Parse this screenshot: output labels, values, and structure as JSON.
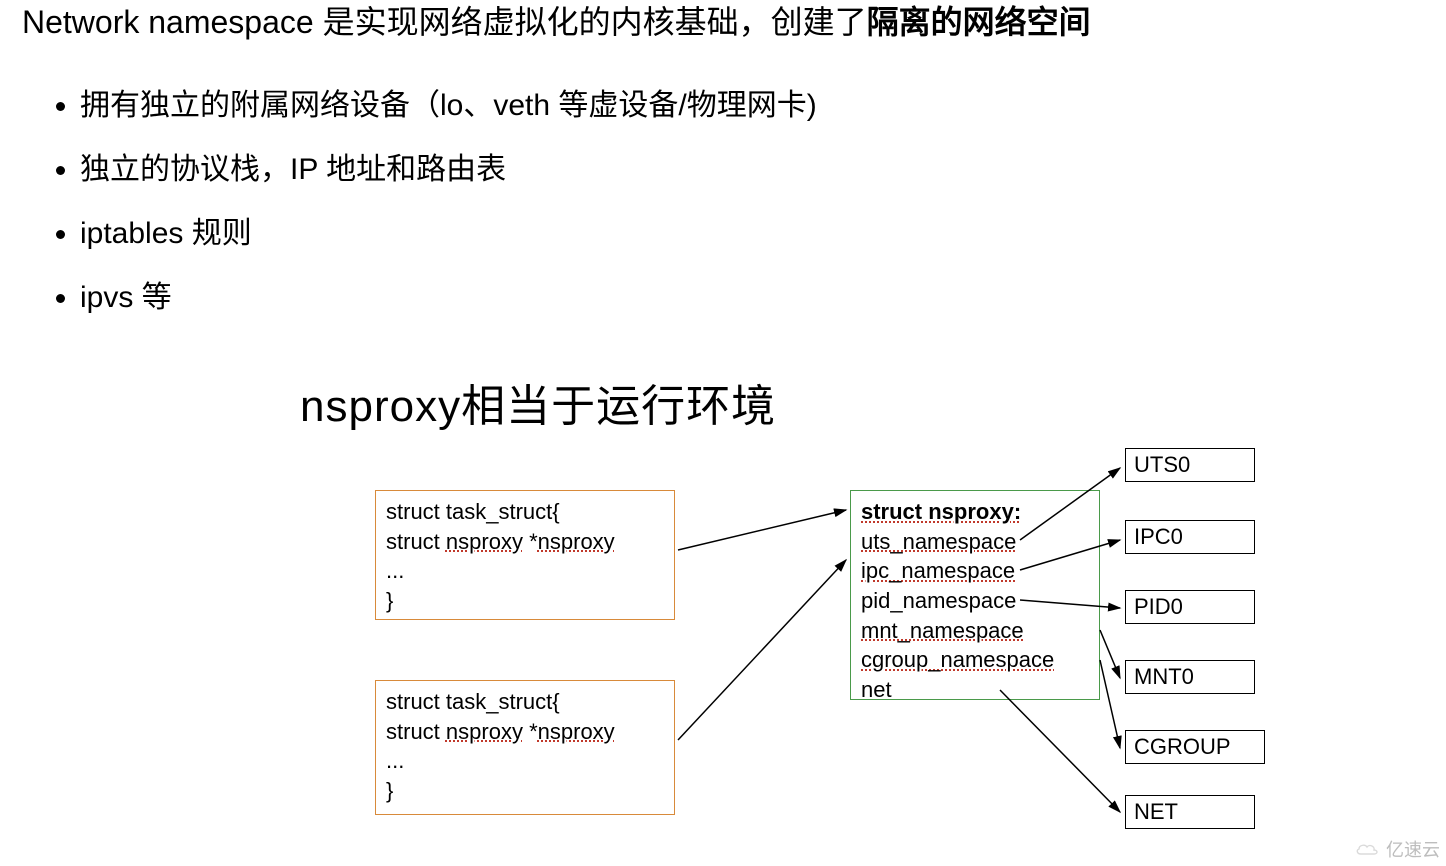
{
  "intro": {
    "prefix": "Network namespace 是实现网络虚拟化的内核基础，创建了",
    "strong": "隔离的网络空间"
  },
  "bullets": [
    "拥有独立的附属网络设备（lo、veth 等虚设备/物理网卡)",
    "独立的协议栈，IP 地址和路由表",
    "iptables 规则",
    "ipvs 等"
  ],
  "subtitle": "nsproxy相当于运行环境",
  "task_struct": {
    "line1": "struct task_struct{",
    "line2_a": " struct ",
    "line2_b": "nsproxy",
    "line2_c": " *",
    "line2_d": "nsproxy",
    "line3": " ...",
    "line4": "}"
  },
  "nsproxy": {
    "title": "struct nsproxy:",
    "fields": {
      "uts": "uts_namespace",
      "ipc": "ipc_namespace",
      "pid": "pid_namespace",
      "mnt": "mnt_namespace",
      "cgroup": "cgroup_namespace",
      "net": "net"
    }
  },
  "ns_boxes": {
    "uts": "UTS0",
    "ipc": "IPC0",
    "pid": "PID0",
    "mnt": "MNT0",
    "cgroup": "CGROUP",
    "net": "NET"
  },
  "watermark": "亿速云"
}
